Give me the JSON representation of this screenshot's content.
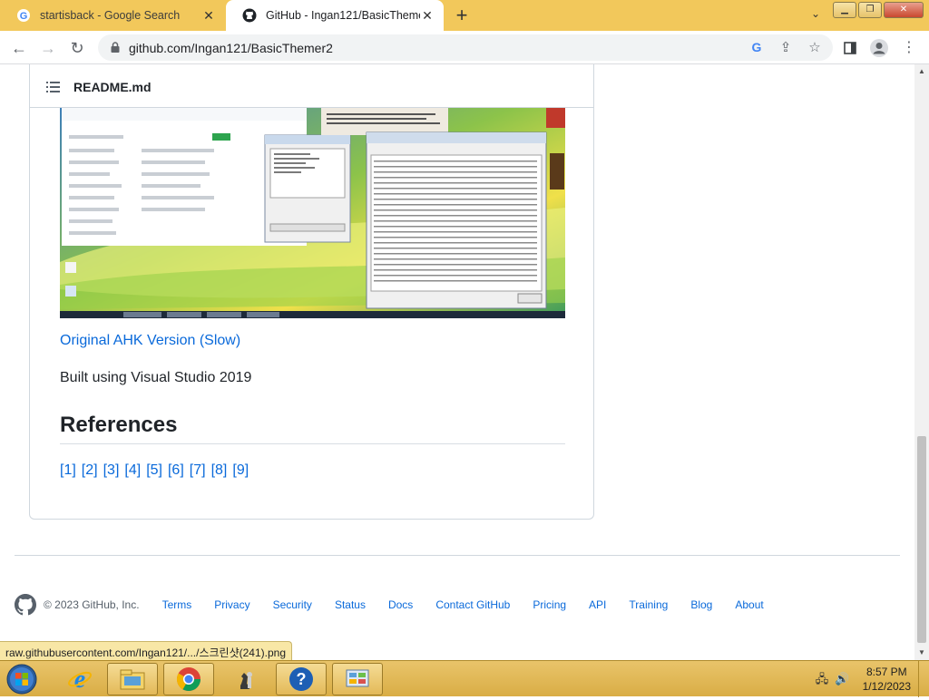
{
  "tabs": [
    {
      "title": "startisback - Google Search",
      "active": false
    },
    {
      "title": "GitHub - Ingan121/BasicThemer2",
      "active": true
    }
  ],
  "toolbar": {
    "url": "github.com/Ingan121/BasicThemer2"
  },
  "readme": {
    "filename": "README.md",
    "original_link": "Original AHK Version (Slow)",
    "built_text": "Built using Visual Studio 2019",
    "references_heading": "References",
    "references": [
      "[1]",
      "[2]",
      "[3]",
      "[4]",
      "[5]",
      "[6]",
      "[7]",
      "[8]",
      "[9]"
    ]
  },
  "footer": {
    "copyright": "© 2023 GitHub, Inc.",
    "links": [
      "Terms",
      "Privacy",
      "Security",
      "Status",
      "Docs",
      "Contact GitHub",
      "Pricing",
      "API",
      "Training",
      "Blog",
      "About"
    ]
  },
  "status_bubble": "raw.githubusercontent.com/Ingan121/.../스크린샷(241).png",
  "taskbar": {
    "time": "8:57 PM",
    "date": "1/12/2023"
  },
  "colors": {
    "chrome_frame": "#f2c85b",
    "link": "#0969da",
    "taskbar": "#e3b958"
  },
  "icons": [
    "google-icon",
    "github-icon",
    "close-icon",
    "plus-icon",
    "back-icon",
    "forward-icon",
    "reload-icon",
    "lock-icon",
    "share-icon",
    "star-icon",
    "sidepanel-icon",
    "profile-icon",
    "menu-icon",
    "list-icon",
    "start-icon",
    "ie-icon",
    "explorer-icon",
    "chrome-icon",
    "help-icon"
  ]
}
